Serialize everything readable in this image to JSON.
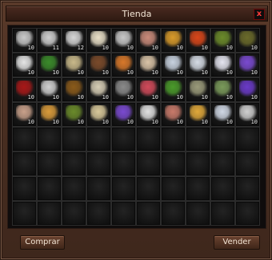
{
  "window": {
    "title": "Tienda",
    "close_label": "x"
  },
  "buttons": {
    "buy": "Comprar",
    "sell": "Vender"
  },
  "colors": {
    "accent": "#5a3a2a",
    "close": "#ff3b3b"
  },
  "shop": {
    "rows": 8,
    "cols": 10,
    "items": [
      {
        "icon": "fish-bone-icon",
        "qty": "10",
        "color": "#c9c9c9"
      },
      {
        "icon": "fish-bone-icon",
        "qty": "11",
        "color": "#cfcfcf"
      },
      {
        "icon": "fish-bone-icon",
        "qty": "12",
        "color": "#d5d5d5"
      },
      {
        "icon": "tusk-icon",
        "qty": "10",
        "color": "#e9e0c8"
      },
      {
        "icon": "feather-icon",
        "qty": "10",
        "color": "#c8c8c8"
      },
      {
        "icon": "scroll-icon",
        "qty": "10",
        "color": "#c98a7a"
      },
      {
        "icon": "gold-nugget-icon",
        "qty": "10",
        "color": "#d89a2a"
      },
      {
        "icon": "fire-orb-icon",
        "qty": "10",
        "color": "#d8461a"
      },
      {
        "icon": "horn-icon",
        "qty": "10",
        "color": "#6b8a2a"
      },
      {
        "icon": "pouch-icon",
        "qty": "10",
        "color": "#6a6a2a"
      },
      {
        "icon": "paper-icon",
        "qty": "10",
        "color": "#e5e5e5"
      },
      {
        "icon": "leaf-icon",
        "qty": "10",
        "color": "#3a8a2a"
      },
      {
        "icon": "claw-icon",
        "qty": "10",
        "color": "#c9b98a"
      },
      {
        "icon": "hook-icon",
        "qty": "10",
        "color": "#7a4a2a"
      },
      {
        "icon": "worm-icon",
        "qty": "10",
        "color": "#d8782a"
      },
      {
        "icon": "book-icon",
        "qty": "10",
        "color": "#d9c3a6"
      },
      {
        "icon": "crystal-icon",
        "qty": "10",
        "color": "#c8d2e0"
      },
      {
        "icon": "crystal-icon",
        "qty": "10",
        "color": "#d5dbe5"
      },
      {
        "icon": "diamond-icon",
        "qty": "10",
        "color": "#e5e5f0"
      },
      {
        "icon": "rune-card-icon",
        "qty": "10",
        "color": "#7a4ad0"
      },
      {
        "icon": "red-claw-icon",
        "qty": "10",
        "color": "#a81818"
      },
      {
        "icon": "spiky-ball-icon",
        "qty": "10",
        "color": "#d0d0d0"
      },
      {
        "icon": "nut-icon",
        "qty": "10",
        "color": "#8a5a1a"
      },
      {
        "icon": "stone-icon",
        "qty": "10",
        "color": "#d6cdb5"
      },
      {
        "icon": "branch-icon",
        "qty": "10",
        "color": "#8a8a8a"
      },
      {
        "icon": "tongue-icon",
        "qty": "10",
        "color": "#d04a5a"
      },
      {
        "icon": "snake-icon",
        "qty": "10",
        "color": "#4a9a2a"
      },
      {
        "icon": "net-icon",
        "qty": "10",
        "color": "#9a9a7a"
      },
      {
        "icon": "green-book-icon",
        "qty": "10",
        "color": "#7a9a5a"
      },
      {
        "icon": "rune-card-icon",
        "qty": "10",
        "color": "#6a3ac8"
      },
      {
        "icon": "red-book-icon",
        "qty": "10",
        "color": "#c8a08a"
      },
      {
        "icon": "fang-icon",
        "qty": "10",
        "color": "#d89a3a"
      },
      {
        "icon": "vine-icon",
        "qty": "10",
        "color": "#6a8a2a"
      },
      {
        "icon": "map-icon",
        "qty": "10",
        "color": "#d8c89a"
      },
      {
        "icon": "rune-card-icon",
        "qty": "10",
        "color": "#7a4ad0"
      },
      {
        "icon": "paper-icon",
        "qty": "10",
        "color": "#e0e0e0"
      },
      {
        "icon": "brick-icon",
        "qty": "10",
        "color": "#c87a6a"
      },
      {
        "icon": "gold-coin-icon",
        "qty": "10",
        "color": "#e0a83a"
      },
      {
        "icon": "crystal-icon",
        "qty": "10",
        "color": "#d0d8e5"
      },
      {
        "icon": "feather-icon",
        "qty": "10",
        "color": "#cfcfcf"
      }
    ]
  }
}
